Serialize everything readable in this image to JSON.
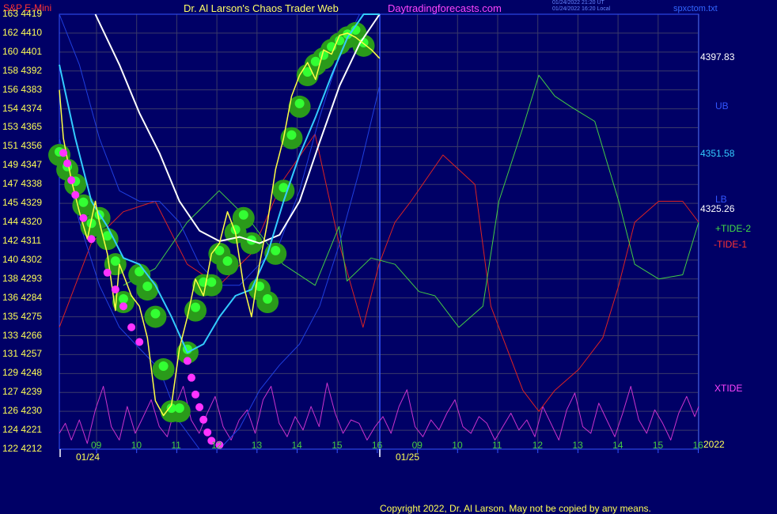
{
  "header": {
    "symbol": "S&P E-Mini",
    "brand": "Dr. Al Larson's Chaos Trader Web",
    "site": "Daytradingforecasts.com",
    "stamp1": "01/24/2022 21:20 UT",
    "stamp2": "01/24/2022 16:20 Local",
    "file": "spxctom.txt"
  },
  "footer": {
    "copyright": "Copyright 2022, Dr. Al Larson. May not be copied by any means."
  },
  "colors": {
    "background": "#000066",
    "grid": "#3a3a6a",
    "frame": "#3355ff",
    "white_ma": "#ffffff",
    "cyan_ma": "#33ccff",
    "blue_band": "#1f3fe0",
    "price_line": "#ffff44",
    "tide_plus": "#44cc44",
    "tide_minus": "#dd2222",
    "xtide": "#cc33cc",
    "bubble": "#2a9a1a",
    "dot_green": "#33ff33",
    "dot_magenta": "#ff33ff"
  },
  "chart_data": {
    "type": "line",
    "title": "S&P E-Mini",
    "left_axis_ticks": [
      {
        "index": "163",
        "price": "4419"
      },
      {
        "index": "162",
        "price": "4410"
      },
      {
        "index": "160",
        "price": "4401"
      },
      {
        "index": "158",
        "price": "4392"
      },
      {
        "index": "156",
        "price": "4383"
      },
      {
        "index": "154",
        "price": "4374"
      },
      {
        "index": "153",
        "price": "4365"
      },
      {
        "index": "151",
        "price": "4356"
      },
      {
        "index": "149",
        "price": "4347"
      },
      {
        "index": "147",
        "price": "4338"
      },
      {
        "index": "145",
        "price": "4329"
      },
      {
        "index": "144",
        "price": "4320"
      },
      {
        "index": "142",
        "price": "4311"
      },
      {
        "index": "140",
        "price": "4302"
      },
      {
        "index": "138",
        "price": "4293"
      },
      {
        "index": "136",
        "price": "4284"
      },
      {
        "index": "135",
        "price": "4275"
      },
      {
        "index": "133",
        "price": "4266"
      },
      {
        "index": "131",
        "price": "4257"
      },
      {
        "index": "129",
        "price": "4248"
      },
      {
        "index": "127",
        "price": "4239"
      },
      {
        "index": "126",
        "price": "4230"
      },
      {
        "index": "124",
        "price": "4221"
      },
      {
        "index": "122",
        "price": "4212"
      }
    ],
    "y_range": [
      4212,
      4419
    ],
    "x_hour_labels": [
      "09",
      "10",
      "11",
      "12",
      "13",
      "14",
      "15",
      "16",
      "09",
      "10",
      "11",
      "12",
      "13",
      "14",
      "15",
      "16"
    ],
    "x_date_labels": [
      "01/24",
      "01/25"
    ],
    "year_label": "2022",
    "right_labels": {
      "price_high": "4397.83",
      "ub": "UB",
      "price_mid": "4351.58",
      "lb": "LB",
      "price_last": "4325.26",
      "tide_plus": "+TIDE-2",
      "tide_minus": "-TIDE-1",
      "xtide": "XTIDE"
    },
    "series": [
      {
        "key": "price",
        "color": "#ffff44",
        "x": [
          0,
          0.1,
          0.3,
          0.5,
          0.7,
          0.9,
          1.0,
          1.2,
          1.4,
          1.5,
          1.6,
          1.8,
          2.0,
          2.2,
          2.4,
          2.6,
          2.8,
          3.0,
          3.2,
          3.4,
          3.6,
          3.8,
          4.0,
          4.2,
          4.4,
          4.6,
          4.8,
          5.0,
          5.2,
          5.4,
          5.6,
          5.8,
          6.0,
          6.2,
          6.4,
          6.6,
          6.8,
          7.0,
          7.2,
          7.4,
          7.6,
          7.8,
          8.0
        ],
        "y": [
          4383,
          4360,
          4340,
          4325,
          4312,
          4330,
          4320,
          4305,
          4278,
          4300,
          4295,
          4285,
          4280,
          4265,
          4235,
          4228,
          4233,
          4260,
          4275,
          4293,
          4285,
          4305,
          4310,
          4325,
          4315,
          4290,
          4275,
          4300,
          4320,
          4345,
          4360,
          4380,
          4390,
          4396,
          4388,
          4402,
          4400,
          4409,
          4410,
          4408,
          4405,
          4402,
          4398
        ]
      },
      {
        "key": "ma_white",
        "color": "#ffffff",
        "x": [
          0.9,
          1.5,
          2.0,
          2.5,
          3.0,
          3.5,
          4.0,
          4.5,
          5.0,
          5.5,
          6.0,
          6.5,
          7.0,
          7.5,
          8.0
        ],
        "y": [
          4419,
          4395,
          4372,
          4353,
          4330,
          4316,
          4311,
          4313,
          4310,
          4314,
          4330,
          4358,
          4385,
          4405,
          4419
        ]
      },
      {
        "key": "ma_cyan",
        "color": "#33ccff",
        "x": [
          0,
          0.4,
          0.8,
          1.2,
          1.6,
          2.0,
          2.4,
          2.8,
          3.2,
          3.6,
          4.0,
          4.4,
          4.8,
          5.2,
          5.6,
          6.0,
          6.4,
          6.8,
          7.2,
          7.6,
          8.0
        ],
        "y": [
          4395,
          4360,
          4330,
          4318,
          4303,
          4300,
          4290,
          4275,
          4258,
          4262,
          4275,
          4285,
          4288,
          4305,
          4330,
          4352,
          4370,
          4390,
          4408,
          4419,
          4419
        ]
      },
      {
        "key": "band_upper",
        "color": "#1f3fe0",
        "x": [
          0,
          0.5,
          1.0,
          1.5,
          2.0,
          2.5,
          3.0,
          3.5,
          4.0,
          4.5,
          5.0,
          5.5,
          6.0,
          6.5,
          7.0,
          7.5,
          8.0
        ],
        "y": [
          4419,
          4395,
          4360,
          4335,
          4330,
          4330,
          4320,
          4300,
          4290,
          4290,
          4300,
          4310,
          4335,
          4370,
          4400,
          4419,
          4419
        ]
      },
      {
        "key": "band_lower",
        "color": "#1f3fe0",
        "x": [
          0,
          0.5,
          1.0,
          1.5,
          2.0,
          2.5,
          3.0,
          3.5,
          4.0,
          4.5,
          5.0,
          5.5,
          6.0,
          6.5,
          7.0,
          7.5,
          8.0
        ],
        "y": [
          4360,
          4320,
          4290,
          4270,
          4260,
          4250,
          4225,
          4212,
          4212,
          4222,
          4240,
          4252,
          4262,
          4280,
          4310,
          4345,
          4385
        ]
      }
    ],
    "tides": {
      "x_range": [
        0,
        16
      ],
      "plus_x": [
        1.6,
        2.4,
        3.2,
        4.0,
        4.8,
        5.6,
        6.4,
        7.0,
        7.2,
        7.8,
        8.4,
        9.0,
        9.4,
        10.0,
        10.6,
        11.0,
        11.6,
        12.0,
        12.4,
        12.8,
        13.4,
        14.0,
        14.4,
        15.0,
        15.6,
        16.0
      ],
      "plus_y": [
        4290,
        4298,
        4320,
        4335,
        4320,
        4300,
        4290,
        4318,
        4292,
        4303,
        4300,
        4287,
        4285,
        4270,
        4280,
        4330,
        4365,
        4390,
        4380,
        4375,
        4368,
        4330,
        4300,
        4293,
        4295,
        4320
      ],
      "minus_x": [
        0,
        0.8,
        1.6,
        2.4,
        3.2,
        4.0,
        4.8,
        5.6,
        6.4,
        7.0,
        7.6,
        8.0,
        8.4,
        8.8,
        9.6,
        10.4,
        10.8,
        11.6,
        12.0,
        12.4,
        13.0,
        13.6,
        14.0,
        14.4,
        15.0,
        15.6,
        16.0
      ],
      "minus_y": [
        4270,
        4310,
        4325,
        4330,
        4300,
        4290,
        4305,
        4340,
        4362,
        4310,
        4270,
        4300,
        4320,
        4330,
        4352,
        4338,
        4280,
        4240,
        4230,
        4240,
        4250,
        4265,
        4290,
        4320,
        4330,
        4330,
        4320
      ],
      "x_points": [
        0,
        0.15,
        0.3,
        0.5,
        0.7,
        0.9,
        1.1,
        1.3,
        1.5,
        1.7,
        1.9,
        2.1,
        2.3,
        2.5,
        2.7,
        2.9,
        3.1,
        3.3,
        3.5,
        3.7,
        3.9,
        4.1,
        4.3,
        4.5,
        4.7,
        4.9,
        5.1,
        5.3,
        5.5,
        5.7,
        5.9,
        6.1,
        6.3,
        6.5,
        6.7,
        6.9,
        7.1,
        7.3,
        7.5,
        7.7,
        7.9,
        8.1,
        8.3,
        8.5,
        8.7,
        8.9,
        9.1,
        9.3,
        9.5,
        9.7,
        9.9,
        10.1,
        10.3,
        10.5,
        10.7,
        10.9,
        11.1,
        11.3,
        11.5,
        11.7,
        11.9,
        12.1,
        12.3,
        12.5,
        12.7,
        12.9,
        13.1,
        13.3,
        13.5,
        13.7,
        13.9,
        14.1,
        14.3,
        14.5,
        14.7,
        14.9,
        15.1,
        15.3,
        15.5,
        15.7,
        15.9,
        16.0
      ],
      "x_values": [
        0.2,
        0.35,
        0.1,
        0.4,
        0.05,
        0.55,
        0.9,
        0.3,
        0.1,
        0.6,
        0.2,
        0.45,
        0.7,
        0.3,
        0.15,
        0.6,
        0.9,
        0.4,
        0.2,
        0.5,
        0.75,
        0.3,
        0.1,
        0.4,
        0.55,
        0.2,
        0.7,
        0.9,
        0.35,
        0.15,
        0.45,
        0.25,
        0.6,
        0.3,
        0.95,
        0.5,
        0.2,
        0.4,
        0.35,
        0.1,
        0.3,
        0.45,
        0.2,
        0.6,
        0.85,
        0.3,
        0.15,
        0.4,
        0.25,
        0.5,
        0.7,
        0.3,
        0.2,
        0.45,
        0.35,
        0.1,
        0.3,
        0.5,
        0.25,
        0.4,
        0.15,
        0.6,
        0.35,
        0.1,
        0.55,
        0.8,
        0.3,
        0.2,
        0.65,
        0.4,
        0.15,
        0.5,
        0.9,
        0.4,
        0.2,
        0.55,
        0.35,
        0.1,
        0.5,
        0.75,
        0.45,
        0.6
      ]
    },
    "bubbles_x": [
      0,
      0.2,
      0.4,
      0.6,
      0.8,
      1.0,
      1.2,
      1.4,
      1.6,
      2.0,
      2.2,
      2.4,
      2.6,
      2.8,
      3.0,
      3.2,
      3.4,
      3.6,
      3.8,
      4.0,
      4.2,
      4.4,
      4.6,
      4.8,
      5.0,
      5.2,
      5.4,
      5.6,
      5.8,
      6.0,
      6.2,
      6.4,
      6.6,
      6.8,
      7.0,
      7.2,
      7.4,
      7.6
    ],
    "bubbles_y": [
      4352,
      4345,
      4338,
      4328,
      4318,
      4322,
      4312,
      4300,
      4282,
      4295,
      4288,
      4275,
      4250,
      4230,
      4230,
      4258,
      4278,
      4290,
      4290,
      4305,
      4300,
      4315,
      4322,
      4310,
      4288,
      4282,
      4305,
      4335,
      4360,
      4375,
      4390,
      4395,
      4398,
      4402,
      4405,
      4408,
      4410,
      4404
    ],
    "dots_magenta_x": [
      0.1,
      0.2,
      0.3,
      0.4,
      0.6,
      0.8,
      1.2,
      1.4,
      1.6,
      1.8,
      2.0,
      3.2,
      3.3,
      3.4,
      3.5,
      3.6,
      3.7,
      3.8,
      4.0
    ],
    "dots_magenta_y": [
      4353,
      4348,
      4340,
      4333,
      4322,
      4312,
      4296,
      4288,
      4280,
      4270,
      4263,
      4254,
      4246,
      4238,
      4232,
      4226,
      4220,
      4216,
      4214
    ]
  }
}
